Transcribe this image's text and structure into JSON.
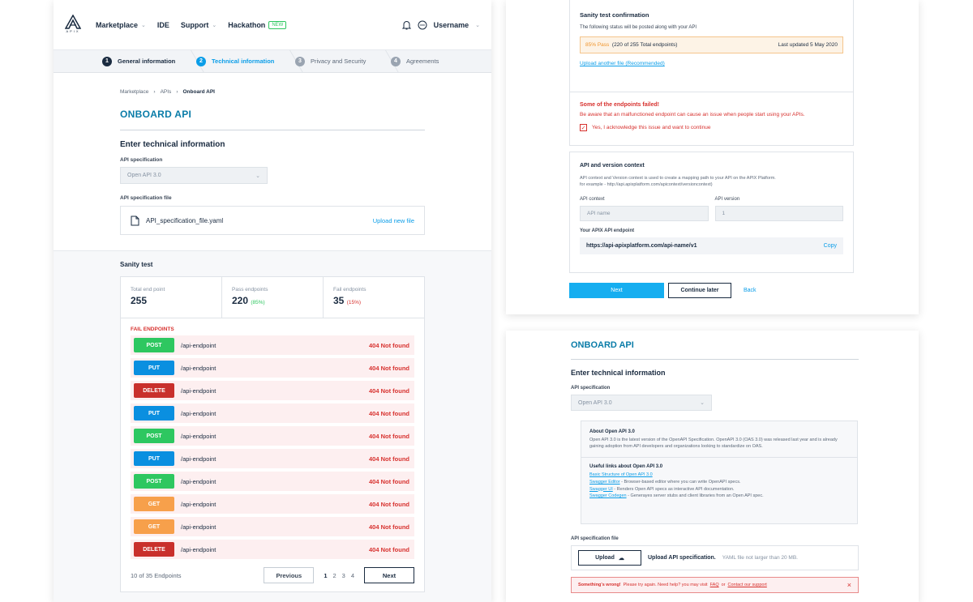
{
  "nav": {
    "items": [
      {
        "label": "Marketplace",
        "chevron": true
      },
      {
        "label": "IDE",
        "chevron": false
      },
      {
        "label": "Support",
        "chevron": true
      },
      {
        "label": "Hackathon",
        "chevron": false
      }
    ],
    "new_badge": "NEW",
    "username": "Username",
    "logo_text": "APIX"
  },
  "steps": [
    {
      "num": "1",
      "label": "General information",
      "state": "done"
    },
    {
      "num": "2",
      "label": "Technical information",
      "state": "active"
    },
    {
      "num": "3",
      "label": "Privacy and Security",
      "state": "pending"
    },
    {
      "num": "4",
      "label": "Agreements",
      "state": "pending"
    }
  ],
  "breadcrumb": [
    "Marketplace",
    "APIs",
    "Onboard API"
  ],
  "title": "ONBOARD API",
  "subtitle": "Enter technical information",
  "spec": {
    "label": "API specification",
    "value": "Open API 3.0"
  },
  "specfile": {
    "label": "API specification file",
    "name": "API_specification_file.yaml",
    "upload": "Upload new file"
  },
  "sanity": {
    "title": "Sanity test",
    "total_label": "Total end point",
    "total": "255",
    "pass_label": "Pass endpoints",
    "pass": "220",
    "pass_pct": "(85%)",
    "fail_label": "Fail endpoints",
    "fail": "35",
    "fail_pct": "(15%)",
    "fail_head": "FAIL ENDPOINTS"
  },
  "rows": [
    {
      "method": "POST",
      "color": "#2ec760",
      "endpoint": "/api-endpoint",
      "status": "404 Not found"
    },
    {
      "method": "PUT",
      "color": "#0a8fe0",
      "endpoint": "/api-endpoint",
      "status": "404 Not found"
    },
    {
      "method": "DELETE",
      "color": "#c9302c",
      "endpoint": "/api-endpoint",
      "status": "404 Not found"
    },
    {
      "method": "PUT",
      "color": "#0a8fe0",
      "endpoint": "/api-endpoint",
      "status": "404 Not found"
    },
    {
      "method": "POST",
      "color": "#2ec760",
      "endpoint": "/api-endpoint",
      "status": "404 Not found"
    },
    {
      "method": "PUT",
      "color": "#0a8fe0",
      "endpoint": "/api-endpoint",
      "status": "404 Not found"
    },
    {
      "method": "POST",
      "color": "#2ec760",
      "endpoint": "/api-endpoint",
      "status": "404 Not found"
    },
    {
      "method": "GET",
      "color": "#f7a04b",
      "endpoint": "/api-endpoint",
      "status": "404 Not found"
    },
    {
      "method": "GET",
      "color": "#f7a04b",
      "endpoint": "/api-endpoint",
      "status": "404 Not found"
    },
    {
      "method": "DELETE",
      "color": "#c9302c",
      "endpoint": "/api-endpoint",
      "status": "404 Not found"
    }
  ],
  "pager": {
    "info": "10 of 35 Endpoints",
    "prev": "Previous",
    "pages": [
      "1",
      "2",
      "3",
      "4"
    ],
    "next": "Next"
  },
  "confirm": {
    "title": "Sanity test confirmation",
    "desc": "The following status will be posted along with your API",
    "pass": "85% Pass",
    "detail": "(220 of 255 Total endpoints)",
    "updated": "Last updated 5 May 2020",
    "upload_link": "Upload another file (Recommended)"
  },
  "failwarn": {
    "title": "Some of the endpoints failed!",
    "desc": "Be aware that an malfunctioned endpoint can cause an issue when people start using your APIs.",
    "ack": "Yes, I acknowledge this issue and want to continue"
  },
  "context": {
    "title": "API and version context",
    "desc1": "API context and Version context is used to create a mapping path to your API on the APIX Platform.",
    "desc2": "for example - http://api.apixplatform.com/apicontext/versioncontext)",
    "ctx_label": "API context",
    "ctx_placeholder": "API name",
    "ver_label": "API version",
    "ver_placeholder": "1",
    "endpoint_label": "Your APIX API endpoint",
    "endpoint": "https://api-apixplatform.com/api-name/v1",
    "copy": "Copy"
  },
  "actions": {
    "next": "Next",
    "later": "Continue later",
    "back": "Back"
  },
  "about": {
    "title": "About Open API 3.0",
    "text": "Open API 3.0 is the latest version of the OpenAPI Specification. OpenAPI 3.0 (OAS 3.0) was released last year and is already gaining adoption from API developers and organizations looking to standardize on OAS.",
    "links_title": "Useful links about Open API 3.0",
    "links": [
      {
        "link": "Basic Structure of Open API 3.0",
        "desc": ""
      },
      {
        "link": "Swagger Editor",
        "desc": "- Browser-based editor where you can write OpenAPI specs."
      },
      {
        "link": "Swagger UI",
        "desc": "- Renders Open API specs as interactive API documentation."
      },
      {
        "link": "Swagger Codegen",
        "desc": "- Generayes server stubs and client libraries from an Open API spec."
      }
    ]
  },
  "upload": {
    "label": "API specification file",
    "button": "Upload",
    "title": "Upload API specification.",
    "hint": "YAML file not larger than 20 MB."
  },
  "error": {
    "strong": "Something's wrong!",
    "text": "Please try again. Need help? you may visit",
    "faq": "FAQ",
    "or": "or",
    "support": "Contact our support",
    "close": "×"
  }
}
